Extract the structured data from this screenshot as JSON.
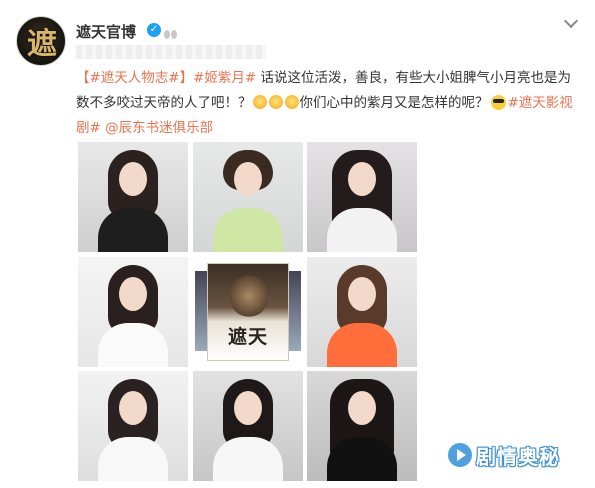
{
  "account": {
    "name": "遮天官博",
    "avatar_text": "遮",
    "verified_icon": "verified-icon",
    "vip_icon": "vip-icon"
  },
  "menu": {
    "icon": "chevron-down-icon"
  },
  "post": {
    "topic_1": "【#遮天人物志#】",
    "topic_2": "#姬紫月#",
    "text_1": " 话说这位活泼，善良，有些大小姐脾气小月亮也是为数不多咬过天帝的人了吧！？",
    "text_2": "你们心中的紫月又是怎样的呢？",
    "topic_3": "#遮天影视剧#",
    "mention": "@辰东书迷俱乐部",
    "emoji_icons": [
      "emoji-icon",
      "emoji-icon",
      "emoji-icon",
      "sunglasses-icon"
    ]
  },
  "photos": [
    {
      "name": "photo-1"
    },
    {
      "name": "photo-2"
    },
    {
      "name": "photo-3"
    },
    {
      "name": "photo-4"
    },
    {
      "name": "photo-5-book-cover",
      "title": "遮天"
    },
    {
      "name": "photo-6"
    },
    {
      "name": "photo-7"
    },
    {
      "name": "photo-8"
    },
    {
      "name": "photo-9"
    }
  ],
  "watermark": {
    "text": "剧情奥秘",
    "icon": "play-icon"
  }
}
